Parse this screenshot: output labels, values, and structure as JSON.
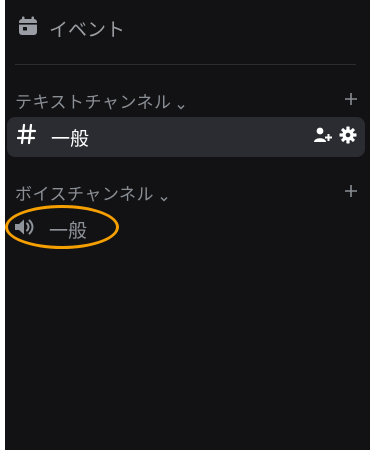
{
  "events": {
    "label": "イベント"
  },
  "text_category": {
    "title": "テキストチャンネル"
  },
  "text_channels": [
    {
      "name": "一般",
      "selected": true
    }
  ],
  "voice_category": {
    "title": "ボイスチャンネル"
  },
  "voice_channels": [
    {
      "name": "一般",
      "highlighted": true
    }
  ],
  "colors": {
    "panel_bg": "#121214",
    "selected_bg": "#2b2c31",
    "highlight": "#f5a000",
    "muted_text": "#8a8e95",
    "active_text": "#ffffff"
  },
  "icons": {
    "events": "calendar-icon",
    "text_channel": "hash-icon",
    "voice_channel": "speaker-icon",
    "invite": "add-member-icon",
    "settings": "gear-icon",
    "category_toggle": "chevron-down-icon",
    "create_channel": "plus-icon"
  }
}
